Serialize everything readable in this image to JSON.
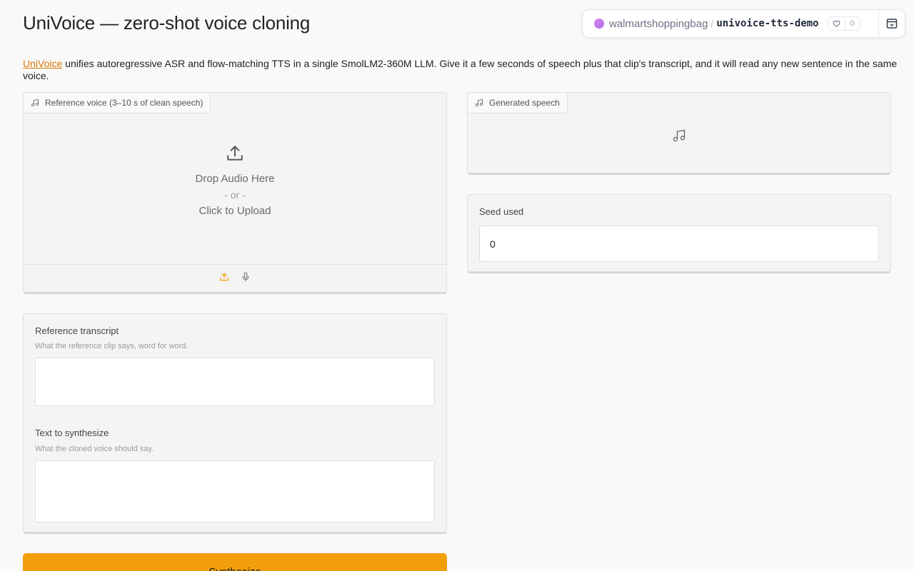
{
  "header": {
    "title": "UniVoice — zero-shot voice cloning"
  },
  "hf_badge": {
    "owner": "walmartshoppingbag",
    "separator": "/",
    "repo": "univoice-tts-demo",
    "likes": "0"
  },
  "description": {
    "link_text": "UniVoice",
    "rest": " unifies autoregressive ASR and flow-matching TTS in a single SmolLM2-360M LLM. Give it a few seconds of speech plus that clip's transcript, and it will read any new sentence in the same voice."
  },
  "reference_audio": {
    "label": "Reference voice (3–10 s of clean speech)",
    "drop_text": "Drop Audio Here",
    "or_text": "- or -",
    "click_text": "Click to Upload"
  },
  "transcript": {
    "label": "Reference transcript",
    "info": "What the reference clip says, word for word.",
    "value": ""
  },
  "synth_text": {
    "label": "Text to synthesize",
    "info": "What the cloned voice should say.",
    "value": ""
  },
  "generated": {
    "label": "Generated speech"
  },
  "seed": {
    "label": "Seed used",
    "value": "0"
  },
  "actions": {
    "synthesize_label": "Synthesize"
  },
  "colors": {
    "accent": "#f29e0b",
    "link": "#d97706"
  }
}
